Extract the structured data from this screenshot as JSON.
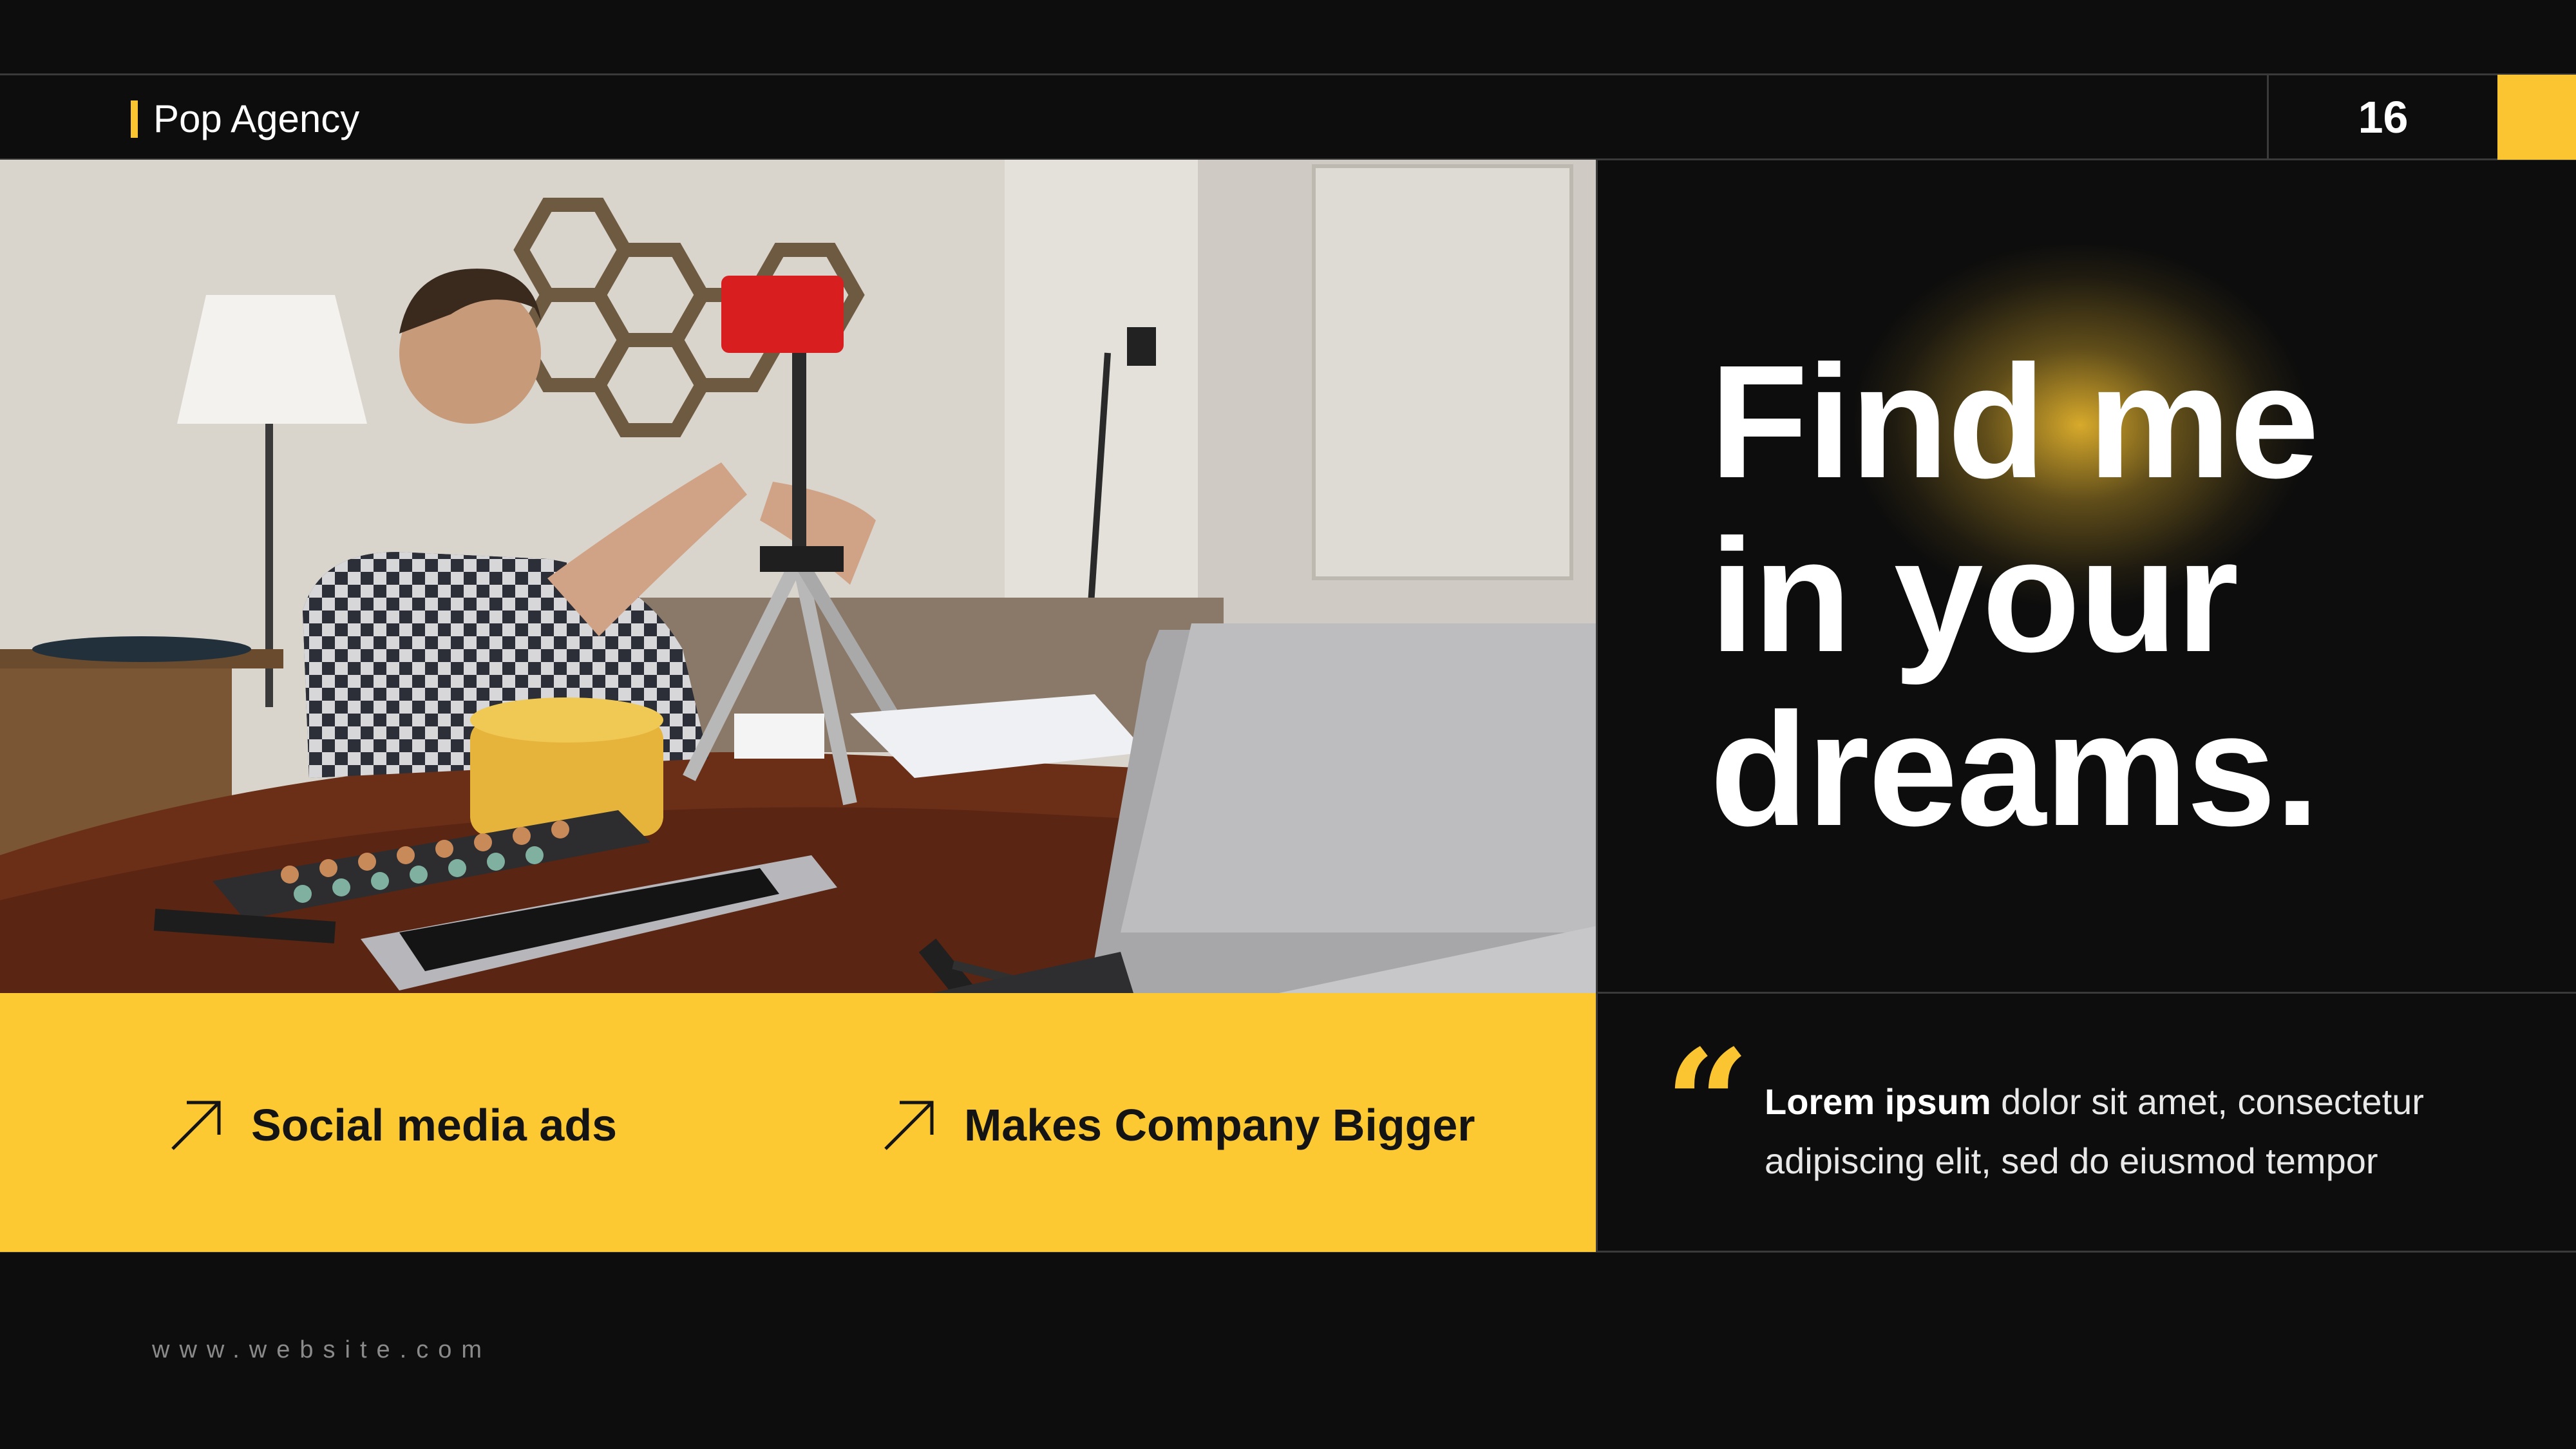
{
  "header": {
    "brand": "Pop Agency",
    "page_number": "16"
  },
  "headline": {
    "line1": "Find me",
    "line2": "in your",
    "line3": "dreams."
  },
  "features": [
    {
      "label": "Social media ads",
      "icon": "arrow-up-right-icon"
    },
    {
      "label": "Makes Company Bigger",
      "icon": "arrow-up-right-icon"
    }
  ],
  "quote": {
    "bold": "Lorem ipsum",
    "rest": " dolor sit amet, consectetur adipiscing elit, sed do eiusmod tempor",
    "icon": "quote-icon"
  },
  "footer": {
    "website": "www.website.com"
  },
  "colors": {
    "accent": "#fbc531",
    "background": "#0d0d0d",
    "band": "#fdc933"
  }
}
